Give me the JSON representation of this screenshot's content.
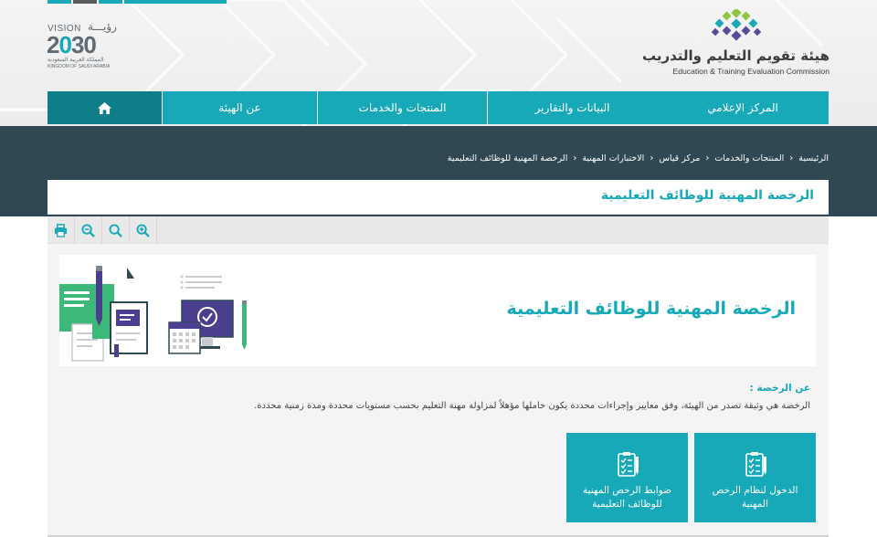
{
  "header": {
    "org_name_ar": "هيئة تقويم التعليم والتدريب",
    "org_name_en": "Education & Training Evaluation Commission",
    "vision": {
      "word": "VISION",
      "arabic": "رؤيـــة",
      "year_a": "2",
      "year_b": "0",
      "year_c": "30",
      "kingdom_ar": "المملكة العربية السعودية",
      "kingdom_en": "KINGDOM OF SAUDI ARABIA"
    }
  },
  "nav": {
    "home_icon": "home-icon",
    "items": [
      {
        "label": "عن الهيئة"
      },
      {
        "label": "المنتجات والخدمات"
      },
      {
        "label": "البيانات والتقارير"
      },
      {
        "label": "المركز الإعلامي"
      }
    ]
  },
  "breadcrumb": {
    "items": [
      {
        "label": "الرئيسية"
      },
      {
        "label": "المنتجات والخدمات"
      },
      {
        "label": "مركز قياس"
      },
      {
        "label": "الاختبارات المهنية"
      },
      {
        "label": "الرخصة المهنية للوظائف التعليمية"
      }
    ]
  },
  "page": {
    "title": "الرخصة المهنية للوظائف التعليمية",
    "hero_title": "الرخصة المهنية للوظائف التعليمية",
    "about_label": "عن الرخصة :",
    "about_text": "الرخصة هي وثيقة تصدر من الهيئة، وفق معايير وإجراءات محددة يكون حاملها مؤهلاً لمزاولة مهنة التعليم بحسب مستويات محددة ومدة زمنية محددة."
  },
  "toolbar": {
    "icons": [
      "print-icon",
      "zoom-out-icon",
      "search-icon",
      "zoom-in-icon"
    ]
  },
  "cards": [
    {
      "label": "الدخول لنظام الرخص المهنية",
      "icon": "checklist-icon"
    },
    {
      "label": "ضوابط الرخص المهنية للوظائف التعليمية",
      "icon": "checklist-icon"
    }
  ],
  "colors": {
    "accent": "#17a9b8",
    "accent_dark": "#0e7e88",
    "band": "#2f4854",
    "logo_green": "#8dc63f",
    "logo_purple": "#5b4a9b"
  }
}
